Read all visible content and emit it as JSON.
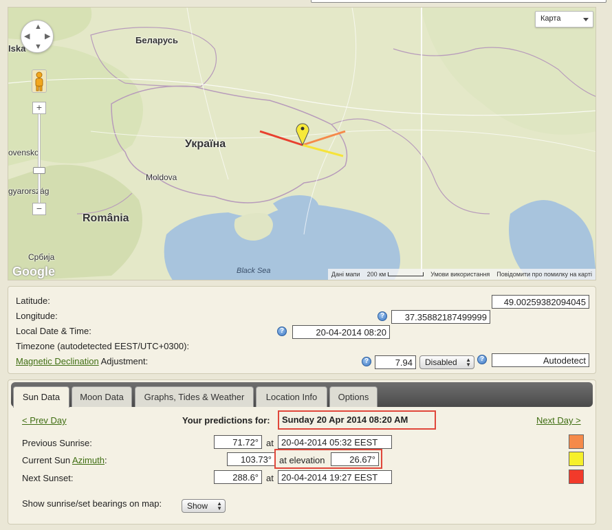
{
  "map": {
    "map_type_label": "Карта",
    "labels": {
      "belarus": "Беларусь",
      "ukraine": "Україна",
      "moldova": "Moldova",
      "romania": "România",
      "serbia": "Србија",
      "black_sea": "Black Sea",
      "iska": "Iska",
      "ovensko": "ovensko",
      "gyarorszag": "gyarország"
    },
    "google_logo": "Google",
    "footer": {
      "map_data": "Дані мапи",
      "scale": "200 км",
      "terms": "Умови використання",
      "report": "Повідомити про помилку на карті"
    },
    "bearing_colors": {
      "sunrise": "#f58a4a",
      "current": "#f6e33a",
      "sunset": "#e8402f"
    }
  },
  "settings": {
    "latitude_label": "Latitude:",
    "latitude_value": "49.00259382094045",
    "longitude_label": "Longitude:",
    "longitude_value": "37.35882187499999",
    "datetime_label": "Local Date & Time:",
    "datetime_value": "20-04-2014 08:20",
    "timezone_label": "Timezone (autodetected EEST/UTC+0300):",
    "declination_link": "Magnetic Declination",
    "declination_suffix": " Adjustment:",
    "declination_value": "7.94",
    "declination_select": "Disabled",
    "autodetect_value": "Autodetect"
  },
  "tabs": [
    {
      "label": "Sun Data",
      "active": true
    },
    {
      "label": "Moon Data",
      "active": false
    },
    {
      "label": "Graphs, Tides & Weather",
      "active": false
    },
    {
      "label": "Location Info",
      "active": false
    },
    {
      "label": "Options",
      "active": false
    }
  ],
  "sun": {
    "prev_day": "< Prev Day",
    "next_day": "Next Day >",
    "predictions_label": "Your predictions for:",
    "predictions_date": "Sunday 20 Apr 2014 08:20 AM",
    "sunrise_label": "Previous Sunrise:",
    "sunrise_bearing": "71.72°",
    "sunrise_at": "at",
    "sunrise_time": "20-04-2014 05:32 EEST",
    "azimuth_prefix": "Current Sun ",
    "azimuth_link": "Azimuth",
    "azimuth_suffix": ":",
    "azimuth_value": "103.73°",
    "elevation_label": "at elevation",
    "elevation_value": "26.67°",
    "sunset_label": "Next Sunset:",
    "sunset_bearing": "288.6°",
    "sunset_at": "at",
    "sunset_time": "20-04-2014 19:27 EEST",
    "show_bearings_label": "Show sunrise/set bearings on map:",
    "show_select": "Show",
    "swatch_colors": [
      "#f58a4a",
      "#f6f02a",
      "#f23a2a"
    ]
  }
}
